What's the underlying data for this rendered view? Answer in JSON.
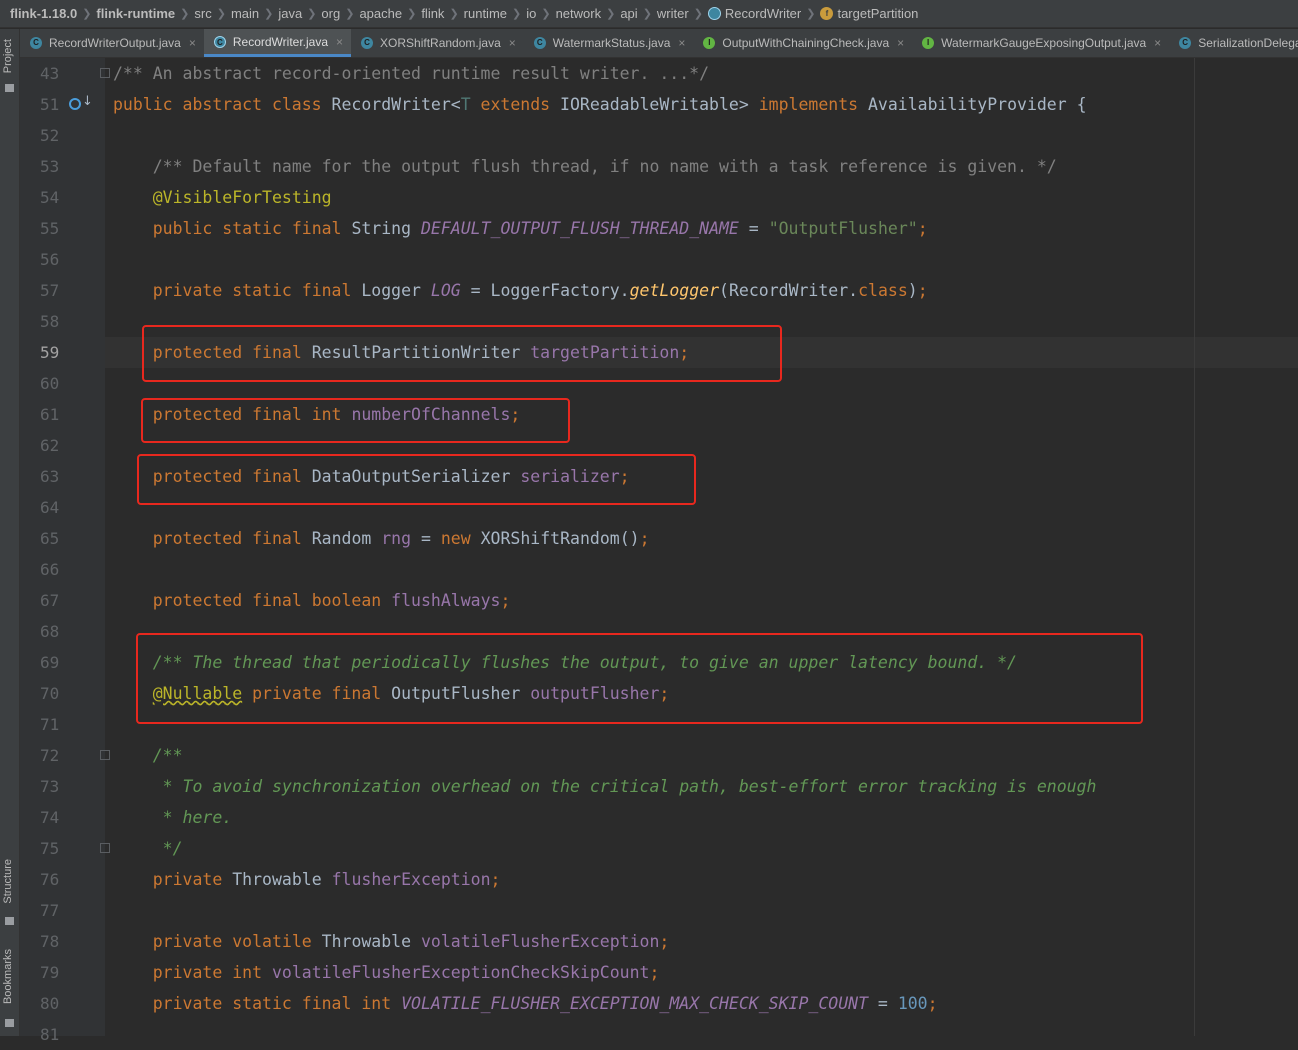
{
  "breadcrumb": [
    {
      "label": "flink-1.18.0",
      "bold": true
    },
    {
      "label": "flink-runtime",
      "bold": true
    },
    {
      "label": "src"
    },
    {
      "label": "main"
    },
    {
      "label": "java"
    },
    {
      "label": "org"
    },
    {
      "label": "apache"
    },
    {
      "label": "flink"
    },
    {
      "label": "runtime"
    },
    {
      "label": "io"
    },
    {
      "label": "network"
    },
    {
      "label": "api"
    },
    {
      "label": "writer"
    },
    {
      "label": "RecordWriter",
      "icon": "abstract-class-icon"
    },
    {
      "label": "targetPartition",
      "icon": "field-icon"
    }
  ],
  "tabs": [
    {
      "label": "RecordWriterOutput.java",
      "icon": "class-icon"
    },
    {
      "label": "RecordWriter.java",
      "icon": "abstract-class-icon",
      "active": true
    },
    {
      "label": "XORShiftRandom.java",
      "icon": "class-icon"
    },
    {
      "label": "WatermarkStatus.java",
      "icon": "class-icon"
    },
    {
      "label": "OutputWithChainingCheck.java",
      "icon": "interface-icon"
    },
    {
      "label": "WatermarkGaugeExposingOutput.java",
      "icon": "interface-icon"
    },
    {
      "label": "SerializationDelegate.",
      "icon": "class-icon"
    }
  ],
  "tool_window": {
    "project": "Project",
    "structure": "Structure",
    "bookmarks": "Bookmarks"
  },
  "lines": [
    {
      "n": "43",
      "tokens": [
        [
          "cmt",
          "/** An abstract record-oriented runtime result writer. ...*/"
        ]
      ]
    },
    {
      "n": "51",
      "tokens": [
        [
          "kw",
          "public abstract class "
        ],
        [
          "plain",
          "RecordWriter<"
        ],
        [
          "typ",
          "T"
        ],
        [
          "kw",
          " extends "
        ],
        [
          "plain",
          "IOReadableWritable> "
        ],
        [
          "kw",
          "implements "
        ],
        [
          "plain",
          "AvailabilityProvider {"
        ]
      ]
    },
    {
      "n": "52",
      "tokens": []
    },
    {
      "n": "53",
      "tokens": [
        [
          "plain",
          "    "
        ],
        [
          "cmt",
          "/** Default name for the output flush thread, if no name with a task reference is given. */"
        ]
      ]
    },
    {
      "n": "54",
      "tokens": [
        [
          "plain",
          "    "
        ],
        [
          "ann",
          "@VisibleForTesting"
        ]
      ]
    },
    {
      "n": "55",
      "tokens": [
        [
          "plain",
          "    "
        ],
        [
          "kw",
          "public static final "
        ],
        [
          "plain",
          "String "
        ],
        [
          "sfld",
          "DEFAULT_OUTPUT_FLUSH_THREAD_NAME"
        ],
        [
          "plain",
          " = "
        ],
        [
          "str",
          "\"OutputFlusher\""
        ],
        [
          "kw",
          ";"
        ]
      ]
    },
    {
      "n": "56",
      "tokens": []
    },
    {
      "n": "57",
      "tokens": [
        [
          "plain",
          "    "
        ],
        [
          "kw",
          "private static final "
        ],
        [
          "plain",
          "Logger "
        ],
        [
          "sfld",
          "LOG"
        ],
        [
          "plain",
          " = LoggerFactory."
        ],
        [
          "mth",
          "getLogger"
        ],
        [
          "plain",
          "(RecordWriter."
        ],
        [
          "kw",
          "class"
        ],
        [
          "plain",
          ")"
        ],
        [
          "kw",
          ";"
        ]
      ]
    },
    {
      "n": "58",
      "tokens": []
    },
    {
      "n": "59",
      "tokens": [
        [
          "plain",
          "    "
        ],
        [
          "kw",
          "protected final "
        ],
        [
          "plain",
          "ResultPartitionWriter "
        ],
        [
          "fld",
          "targetPartition"
        ],
        [
          "kw",
          ";"
        ]
      ],
      "current": true
    },
    {
      "n": "60",
      "tokens": []
    },
    {
      "n": "61",
      "tokens": [
        [
          "plain",
          "    "
        ],
        [
          "kw",
          "protected final int "
        ],
        [
          "fld",
          "numberOfChannels"
        ],
        [
          "kw",
          ";"
        ]
      ]
    },
    {
      "n": "62",
      "tokens": []
    },
    {
      "n": "63",
      "tokens": [
        [
          "plain",
          "    "
        ],
        [
          "kw",
          "protected final "
        ],
        [
          "plain",
          "DataOutputSerializer "
        ],
        [
          "fld",
          "serializer"
        ],
        [
          "kw",
          ";"
        ]
      ]
    },
    {
      "n": "64",
      "tokens": []
    },
    {
      "n": "65",
      "tokens": [
        [
          "plain",
          "    "
        ],
        [
          "kw",
          "protected final "
        ],
        [
          "plain",
          "Random "
        ],
        [
          "fld",
          "rng"
        ],
        [
          "plain",
          " = "
        ],
        [
          "kw",
          "new "
        ],
        [
          "plain",
          "XORShiftRandom()"
        ],
        [
          "kw",
          ";"
        ]
      ]
    },
    {
      "n": "66",
      "tokens": []
    },
    {
      "n": "67",
      "tokens": [
        [
          "plain",
          "    "
        ],
        [
          "kw",
          "protected final boolean "
        ],
        [
          "fld",
          "flushAlways"
        ],
        [
          "kw",
          ";"
        ]
      ]
    },
    {
      "n": "68",
      "tokens": []
    },
    {
      "n": "69",
      "tokens": [
        [
          "plain",
          "    "
        ],
        [
          "doc",
          "/** The thread that periodically flushes the output, to give an upper latency bound. */"
        ]
      ]
    },
    {
      "n": "70",
      "tokens": [
        [
          "plain",
          "    "
        ],
        [
          "ann squig",
          "@Nullable"
        ],
        [
          "kw",
          " private final "
        ],
        [
          "plain",
          "OutputFlusher "
        ],
        [
          "fld",
          "outputFlusher"
        ],
        [
          "kw",
          ";"
        ]
      ]
    },
    {
      "n": "71",
      "tokens": []
    },
    {
      "n": "72",
      "tokens": [
        [
          "plain",
          "    "
        ],
        [
          "doc",
          "/**"
        ]
      ]
    },
    {
      "n": "73",
      "tokens": [
        [
          "plain",
          "    "
        ],
        [
          "doc",
          " * To avoid synchronization overhead on the critical path, best-effort error tracking is enough"
        ]
      ]
    },
    {
      "n": "74",
      "tokens": [
        [
          "plain",
          "    "
        ],
        [
          "doc",
          " * here."
        ]
      ]
    },
    {
      "n": "75",
      "tokens": [
        [
          "plain",
          "    "
        ],
        [
          "doc",
          " */"
        ]
      ]
    },
    {
      "n": "76",
      "tokens": [
        [
          "plain",
          "    "
        ],
        [
          "kw",
          "private "
        ],
        [
          "plain",
          "Throwable "
        ],
        [
          "fld",
          "flusherException"
        ],
        [
          "kw",
          ";"
        ]
      ]
    },
    {
      "n": "77",
      "tokens": []
    },
    {
      "n": "78",
      "tokens": [
        [
          "plain",
          "    "
        ],
        [
          "kw",
          "private volatile "
        ],
        [
          "plain",
          "Throwable "
        ],
        [
          "fld",
          "volatileFlusherException"
        ],
        [
          "kw",
          ";"
        ]
      ]
    },
    {
      "n": "79",
      "tokens": [
        [
          "plain",
          "    "
        ],
        [
          "kw",
          "private int "
        ],
        [
          "fld",
          "volatileFlusherExceptionCheckSkipCount"
        ],
        [
          "kw",
          ";"
        ]
      ]
    },
    {
      "n": "80",
      "tokens": [
        [
          "plain",
          "    "
        ],
        [
          "kw",
          "private static final int "
        ],
        [
          "sfld",
          "VOLATILE_FLUSHER_EXCEPTION_MAX_CHECK_SKIP_COUNT"
        ],
        [
          "plain",
          " = "
        ],
        [
          "num",
          "100"
        ],
        [
          "kw",
          ";"
        ]
      ]
    },
    {
      "n": "81",
      "tokens": []
    }
  ],
  "highlight_color": "#e8281e"
}
